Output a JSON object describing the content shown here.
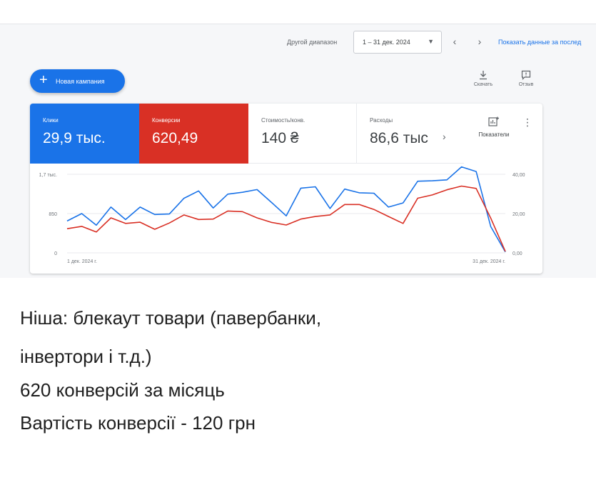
{
  "toolbar": {
    "other_range_label": "Другой диапазон",
    "date_range": "1 – 31 дек. 2024",
    "show_data_label": "Показать данные за послед"
  },
  "actions": {
    "new_campaign": "Новая кампания",
    "download": "Скачать",
    "feedback": "Отзыв"
  },
  "metrics": [
    {
      "label": "Клики",
      "value": "29,9 тыс.",
      "color": "#1a73e8"
    },
    {
      "label": "Конверсии",
      "value": "620,49",
      "color": "#d93025"
    },
    {
      "label": "Стоимость/конв.",
      "value": "140 ₴"
    },
    {
      "label": "Расходы",
      "value": "86,6 тыс"
    }
  ],
  "indicators_label": "Показатели",
  "chart_data": {
    "type": "line",
    "x_start_label": "1 дек. 2024 г.",
    "x_end_label": "31 дек. 2024 г.",
    "y_left_ticks": [
      "1,7 тыс.",
      "850",
      "0"
    ],
    "y_left_range": [
      0,
      1700
    ],
    "y_right_ticks": [
      "40,00",
      "20,00",
      "0,00"
    ],
    "y_right_range": [
      0,
      40
    ],
    "grid": true,
    "series": [
      {
        "name": "Клики",
        "axis": "left",
        "color": "#1a73e8",
        "values": [
          690,
          850,
          600,
          990,
          720,
          990,
          830,
          840,
          1180,
          1340,
          970,
          1270,
          1310,
          1370,
          1090,
          800,
          1400,
          1430,
          960,
          1380,
          1300,
          1290,
          990,
          1080,
          1550,
          1560,
          1580,
          1860,
          1760,
          570,
          20
        ]
      },
      {
        "name": "Конверсии",
        "axis": "right",
        "color": "#d93025",
        "values": [
          12.3,
          13.5,
          10.6,
          17.8,
          15.0,
          15.6,
          12.0,
          15.2,
          19.3,
          17.0,
          17.2,
          21.3,
          21.0,
          17.8,
          15.5,
          14.2,
          17.2,
          18.5,
          19.3,
          24.6,
          24.6,
          22.1,
          18.5,
          15.0,
          27.8,
          29.5,
          32.1,
          34.0,
          32.8,
          17.7,
          0.7
        ]
      }
    ]
  },
  "notes": [
    "Ніша: блекаут товари (павербанки,",
    "інвертори і т.д.)",
    "620 конверсій за місяць",
    "Вартість конверсії - 120 грн"
  ]
}
